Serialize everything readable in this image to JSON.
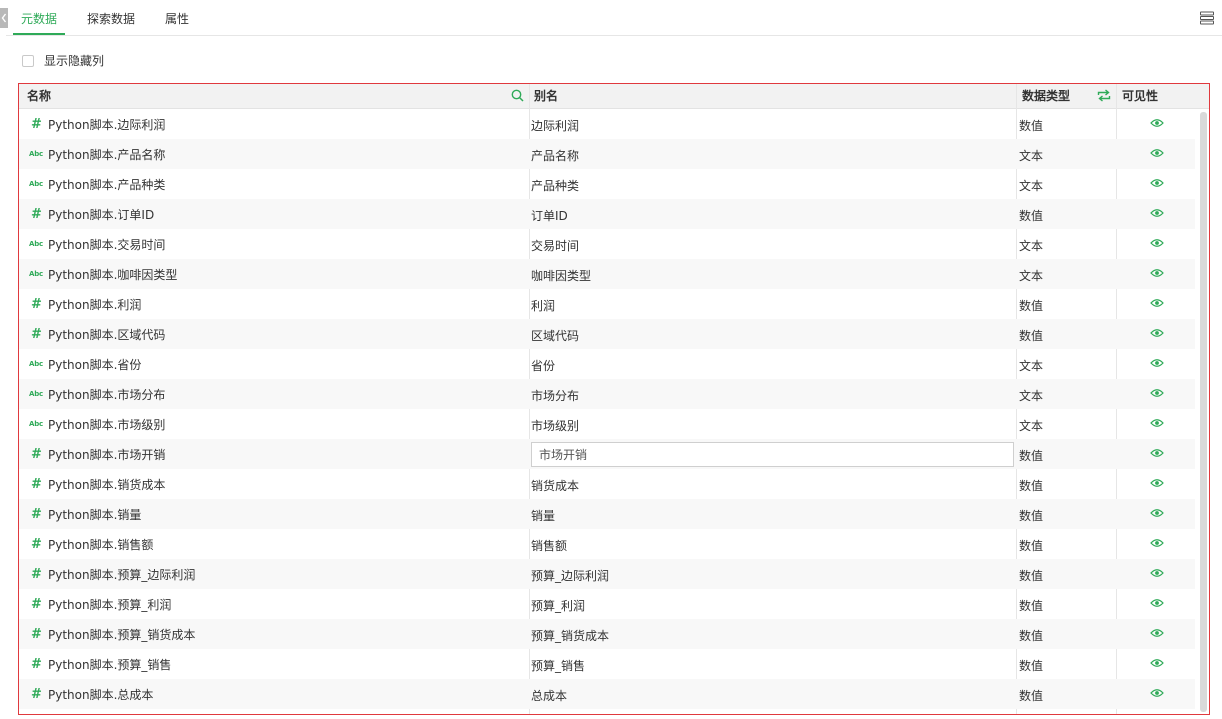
{
  "tabs": [
    {
      "label": "元数据",
      "active": true
    },
    {
      "label": "探索数据",
      "active": false
    },
    {
      "label": "属性",
      "active": false
    }
  ],
  "toolbar": {
    "menu_icon": "list-menu-icon"
  },
  "show_hidden_columns": {
    "label": "显示隐藏列",
    "checked": false
  },
  "table": {
    "headers": {
      "name": "名称",
      "alias": "别名",
      "data_type": "数据类型",
      "visibility": "可见性"
    },
    "rows": [
      {
        "kind": "number",
        "name": "Python脚本.边际利润",
        "alias": "边际利润",
        "type": "数值",
        "visible": true
      },
      {
        "kind": "text",
        "name": "Python脚本.产品名称",
        "alias": "产品名称",
        "type": "文本",
        "visible": true
      },
      {
        "kind": "text",
        "name": "Python脚本.产品种类",
        "alias": "产品种类",
        "type": "文本",
        "visible": true
      },
      {
        "kind": "number",
        "name": "Python脚本.订单ID",
        "alias": "订单ID",
        "type": "数值",
        "visible": true
      },
      {
        "kind": "text",
        "name": "Python脚本.交易时间",
        "alias": "交易时间",
        "type": "文本",
        "visible": true
      },
      {
        "kind": "text",
        "name": "Python脚本.咖啡因类型",
        "alias": "咖啡因类型",
        "type": "文本",
        "visible": true
      },
      {
        "kind": "number",
        "name": "Python脚本.利润",
        "alias": "利润",
        "type": "数值",
        "visible": true
      },
      {
        "kind": "number",
        "name": "Python脚本.区域代码",
        "alias": "区域代码",
        "type": "数值",
        "visible": true
      },
      {
        "kind": "text",
        "name": "Python脚本.省份",
        "alias": "省份",
        "type": "文本",
        "visible": true
      },
      {
        "kind": "text",
        "name": "Python脚本.市场分布",
        "alias": "市场分布",
        "type": "文本",
        "visible": true
      },
      {
        "kind": "text",
        "name": "Python脚本.市场级别",
        "alias": "市场级别",
        "type": "文本",
        "visible": true
      },
      {
        "kind": "number",
        "name": "Python脚本.市场开销",
        "alias": "市场开销",
        "type": "数值",
        "visible": true,
        "editing": true
      },
      {
        "kind": "number",
        "name": "Python脚本.销货成本",
        "alias": "销货成本",
        "type": "数值",
        "visible": true
      },
      {
        "kind": "number",
        "name": "Python脚本.销量",
        "alias": "销量",
        "type": "数值",
        "visible": true
      },
      {
        "kind": "number",
        "name": "Python脚本.销售额",
        "alias": "销售额",
        "type": "数值",
        "visible": true
      },
      {
        "kind": "number",
        "name": "Python脚本.预算_边际利润",
        "alias": "预算_边际利润",
        "type": "数值",
        "visible": true
      },
      {
        "kind": "number",
        "name": "Python脚本.预算_利润",
        "alias": "预算_利润",
        "type": "数值",
        "visible": true
      },
      {
        "kind": "number",
        "name": "Python脚本.预算_销货成本",
        "alias": "预算_销货成本",
        "type": "数值",
        "visible": true
      },
      {
        "kind": "number",
        "name": "Python脚本.预算_销售",
        "alias": "预算_销售",
        "type": "数值",
        "visible": true
      },
      {
        "kind": "number",
        "name": "Python脚本.总成本",
        "alias": "总成本",
        "type": "数值",
        "visible": true
      }
    ]
  },
  "icons": {
    "number": {
      "name": "number-type-icon",
      "glyph": "#"
    },
    "text": {
      "name": "text-type-icon",
      "glyph": "Abc"
    }
  },
  "colors": {
    "accent": "#2faa58",
    "highlight_border": "#e0393e"
  }
}
